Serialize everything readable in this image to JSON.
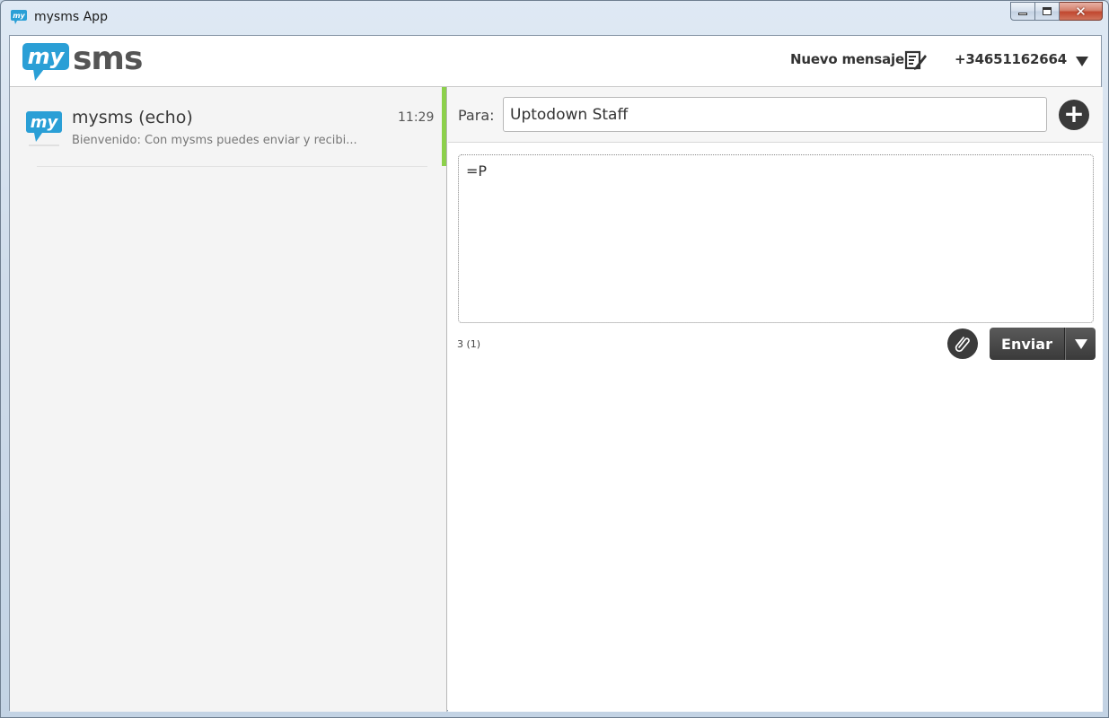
{
  "window": {
    "title": "mysms App",
    "icon": "mysms-app-icon",
    "controls": {
      "minimize": "minimize-icon",
      "maximize": "maximize-icon",
      "close_glyph": "✕"
    }
  },
  "header": {
    "logo_prefix": "my",
    "logo_suffix": "sms",
    "new_message_label": "Nuevo mensaje",
    "new_message_icon": "compose-icon",
    "account_number": "+34651162664",
    "account_dropdown_icon": "triangle-down-icon"
  },
  "conversations": [
    {
      "name": "mysms (echo)",
      "time": "11:29",
      "preview": "Bienvenido: Con mysms puedes enviar y recibi...",
      "avatar": "mysms-avatar-icon",
      "active": true
    }
  ],
  "composer": {
    "to_label": "Para:",
    "to_value": "Uptodown Staff",
    "add_recipient_glyph": "+",
    "message_text": "=P",
    "char_count": "3 (1)",
    "attach_icon": "paperclip-icon",
    "send_label": "Enviar",
    "send_dropdown_icon": "triangle-down-icon"
  },
  "colors": {
    "brand_blue": "#2a9fd6",
    "brand_gray": "#555555",
    "active_accent": "#8cd04b",
    "button_dark": "#3a3a3a"
  }
}
